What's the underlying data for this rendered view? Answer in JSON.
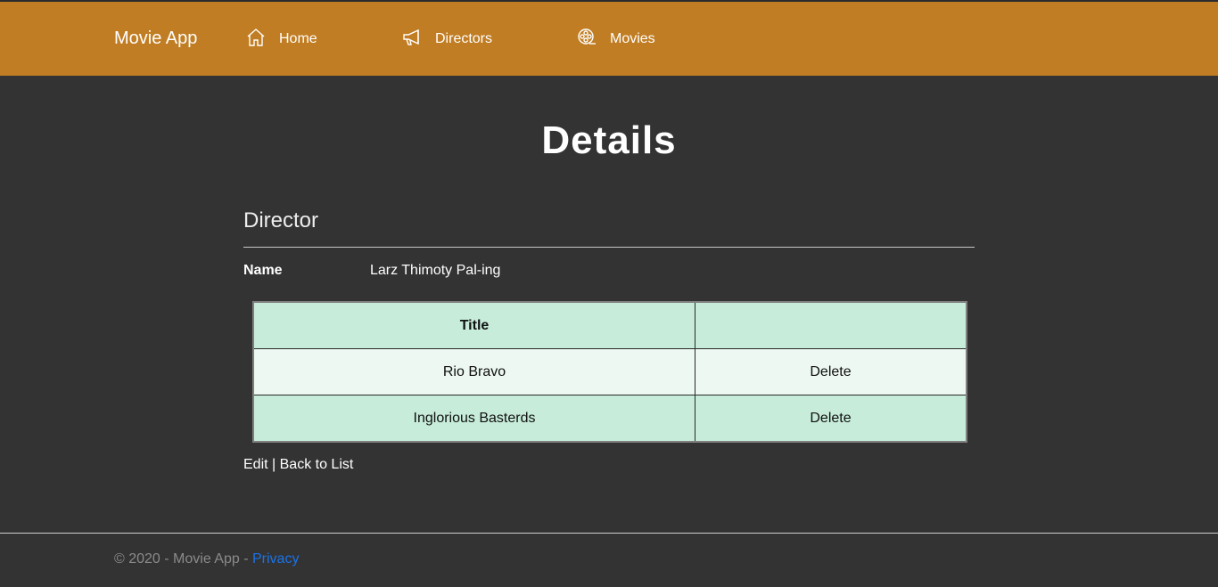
{
  "navbar": {
    "brand": "Movie App",
    "items": [
      {
        "label": "Home",
        "icon": "home-icon"
      },
      {
        "label": "Directors",
        "icon": "megaphone-icon"
      },
      {
        "label": "Movies",
        "icon": "film-reel-icon"
      }
    ],
    "background_color": "#c17d23"
  },
  "main": {
    "title": "Details",
    "section_heading": "Director",
    "fields": [
      {
        "label": "Name",
        "value": "Larz Thimoty Pal-ing"
      }
    ],
    "table": {
      "columns": [
        "Title",
        ""
      ],
      "rows": [
        {
          "title": "Rio Bravo",
          "action": "Delete"
        },
        {
          "title": "Inglorious Basterds",
          "action": "Delete"
        }
      ]
    },
    "links": {
      "edit": "Edit",
      "separator": " | ",
      "back": "Back to List"
    }
  },
  "footer": {
    "text": "© 2020 - Movie App - ",
    "privacy": "Privacy"
  },
  "colors": {
    "page_background": "#333333",
    "table_header": "#c7ecda",
    "table_row_light": "#ecf8f1",
    "link_blue": "#1a73e8"
  }
}
